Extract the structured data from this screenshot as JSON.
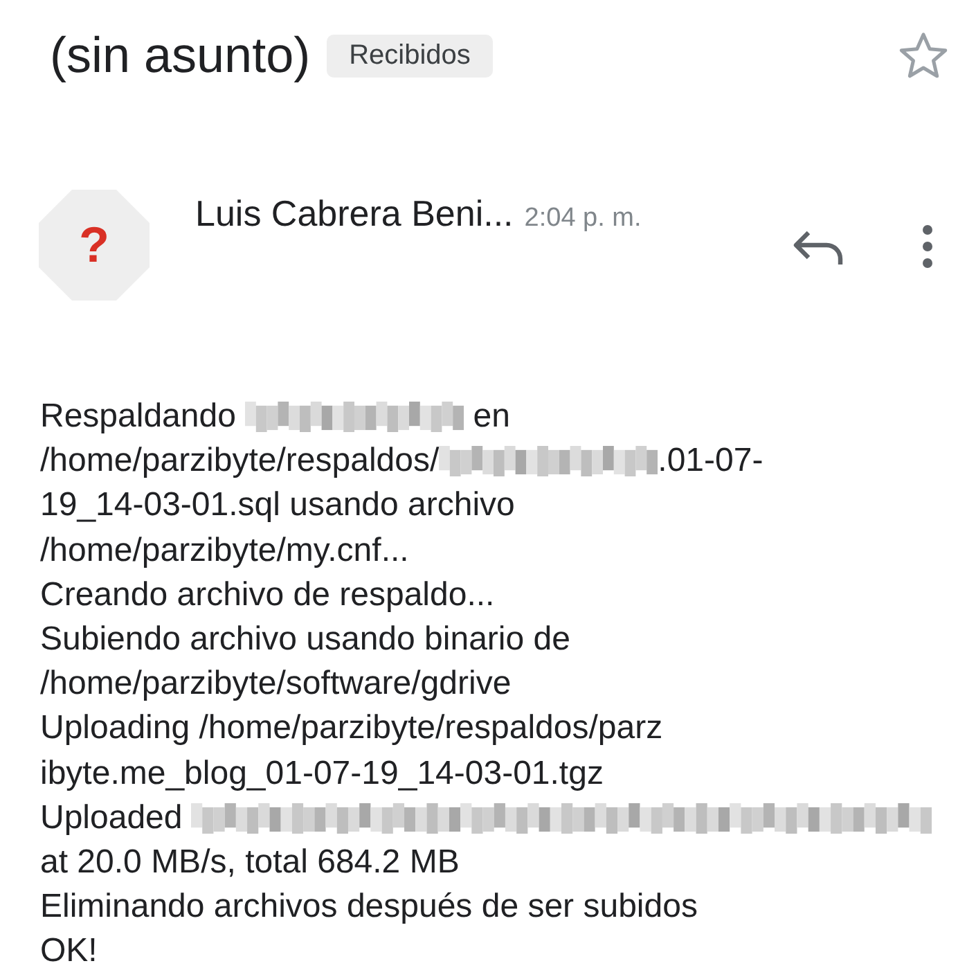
{
  "subject": "(sin asunto)",
  "label": "Recibidos",
  "starred": false,
  "sender": {
    "name": "Luis Cabrera Beni...",
    "time": "2:04 p. m.",
    "avatar": "?"
  },
  "body": [
    [
      {
        "kind": "text",
        "text": "Respaldando "
      },
      {
        "kind": "redacted"
      },
      {
        "kind": "text",
        "text": " en"
      }
    ],
    [
      {
        "kind": "text",
        "text": "/home/parzibyte/respaldos/"
      },
      {
        "kind": "redacted"
      },
      {
        "kind": "text",
        "text": ".01-07-"
      }
    ],
    [
      {
        "kind": "text",
        "text": "19_14-03-01.sql usando archivo"
      }
    ],
    [
      {
        "kind": "text",
        "text": "/home/parzibyte/my.cnf..."
      }
    ],
    [
      {
        "kind": "text",
        "text": "Creando archivo de respaldo..."
      }
    ],
    [
      {
        "kind": "text",
        "text": "Subiendo archivo usando binario de"
      }
    ],
    [
      {
        "kind": "text",
        "text": "/home/parzibyte/software/gdrive"
      }
    ],
    [
      {
        "kind": "text",
        "text": "Uploading /home/parzibyte/respaldos/parz"
      }
    ],
    [
      {
        "kind": "text",
        "text": "ibyte.me_blog_01-07-19_14-03-01.tgz"
      }
    ],
    [
      {
        "kind": "text",
        "text": "Uploaded "
      },
      {
        "kind": "redacted"
      }
    ],
    [
      {
        "kind": "text",
        "text": "at 20.0 MB/s, total 684.2 MB"
      }
    ],
    [
      {
        "kind": "text",
        "text": "Eliminando archivos después de ser subidos"
      }
    ],
    [
      {
        "kind": "text",
        "text": "OK!"
      }
    ]
  ]
}
